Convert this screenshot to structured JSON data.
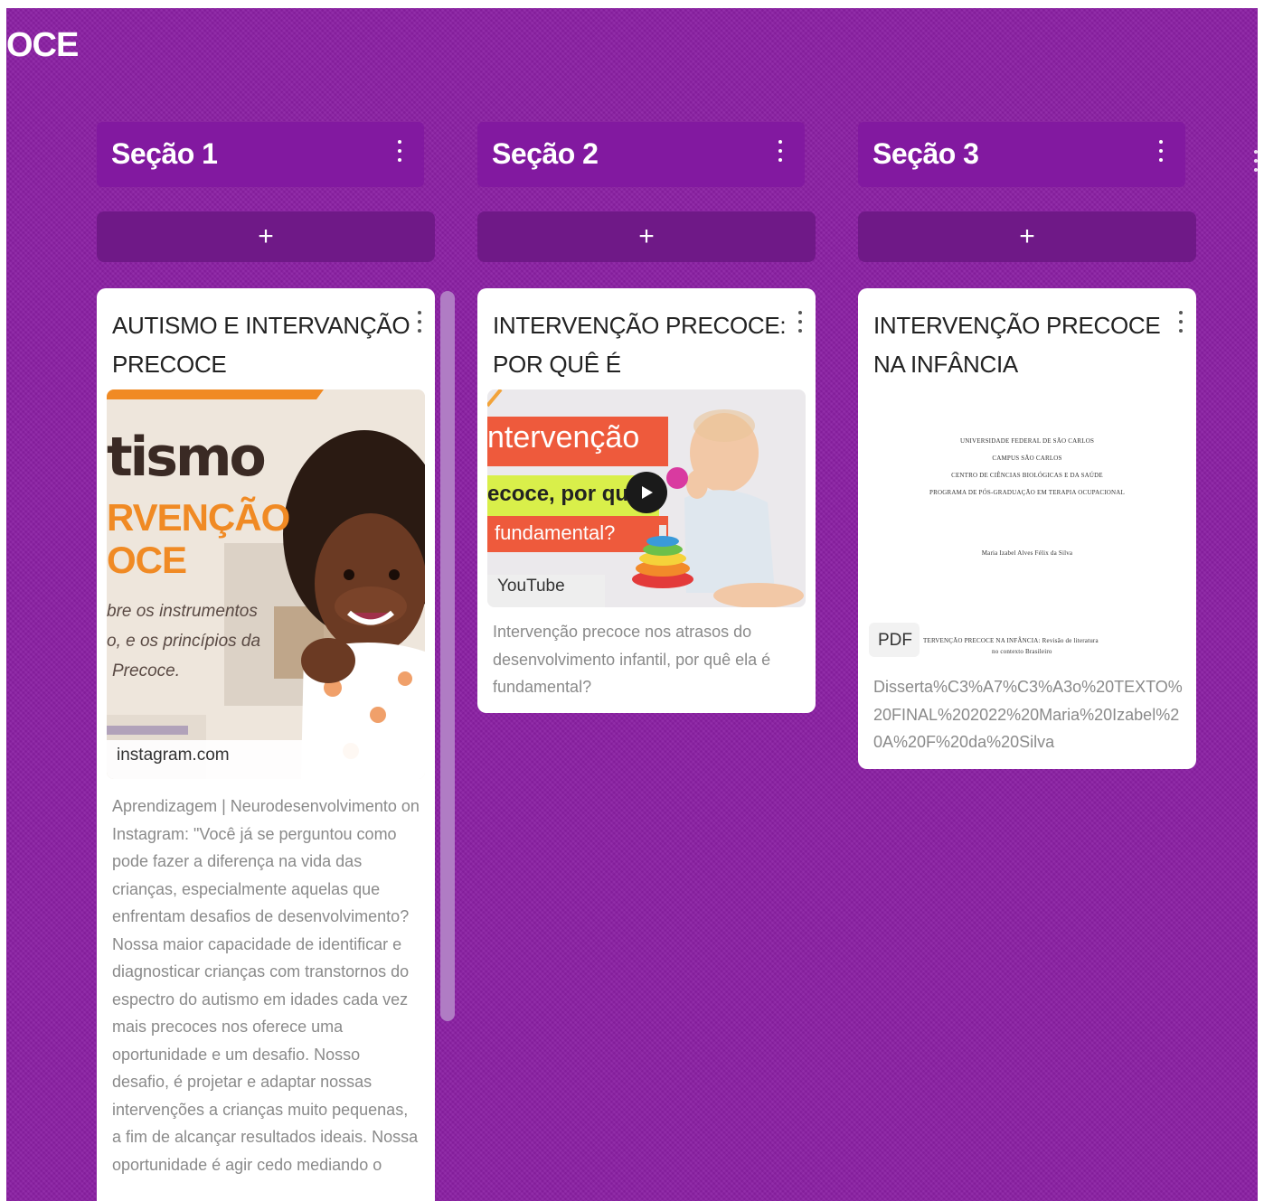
{
  "board": {
    "title": "OCE"
  },
  "sections": [
    {
      "title": "Seção 1",
      "add_label": "+"
    },
    {
      "title": "Seção 2",
      "add_label": "+"
    },
    {
      "title": "Seção 3",
      "add_label": "+"
    }
  ],
  "cards": [
    {
      "title": "AUTISMO E INTERVANÇÃO PRECOCE",
      "source": "instagram.com",
      "thumb_text": {
        "word": "tismo",
        "heading1": "RVENÇÃO",
        "heading2": "OCE",
        "line1": "bre os instrumentos",
        "line2": "o, e os princípios da",
        "line3": "Precoce."
      },
      "description": "Aprendizagem | Neurodesenvolvimento on Instagram: \"Você já se perguntou como pode fazer a diferença na vida das crianças, especialmente aquelas que enfrentam desafios de desenvolvimento? Nossa maior capacidade de identificar e diagnosticar crianças com transtornos do espectro do autismo em idades cada vez mais precoces nos oferece uma oportunidade e um desafio. Nosso desafio, é projetar e adaptar nossas intervenções a crianças muito pequenas, a fim de alcançar resultados ideais. Nossa oportunidade é agir cedo mediando o"
    },
    {
      "title": "INTERVENÇÃO PRECOCE: POR QUÊ É FUNDAMENTAL",
      "source": "YouTube",
      "thumb_text": {
        "line1": "ntervenção",
        "line2": "ecoce, por quê",
        "line3": "fundamental?"
      },
      "description": "Intervenção precoce nos atrasos do desenvolvimento infantil, por quê ela é fundamental?"
    },
    {
      "title": "INTERVENÇÃO PRECOCE NA INFÂNCIA",
      "source": "PDF",
      "pdf_text": {
        "line1": "UNIVERSIDADE FEDERAL DE SÃO CARLOS",
        "line2": "CAMPUS SÃO CARLOS",
        "line3": "CENTRO DE CIÊNCIAS BIOLÓGICAS E DA SAÚDE",
        "line4": "PROGRAMA DE PÓS-GRADUAÇÃO EM TERAPIA OCUPACIONAL",
        "author": "Maria Izabel Alves Félix da Silva",
        "title_line1": "TERVENÇÃO PRECOCE NA INFÂNCIA: Revisão de literatura",
        "title_line2": "no contexto Brasileiro"
      },
      "description": "Disserta%C3%A7%C3%A3o%20TEXTO%20FINAL%202022%20Maria%20Izabel%20A%20F%20da%20Silva"
    }
  ],
  "colors": {
    "board_background": "#8a1fa3",
    "section_header": "#8219a0",
    "add_button": "#6f1987",
    "card_background": "#ffffff",
    "scrollbar": "#b07cc4",
    "accent_orange": "#f08a24"
  }
}
